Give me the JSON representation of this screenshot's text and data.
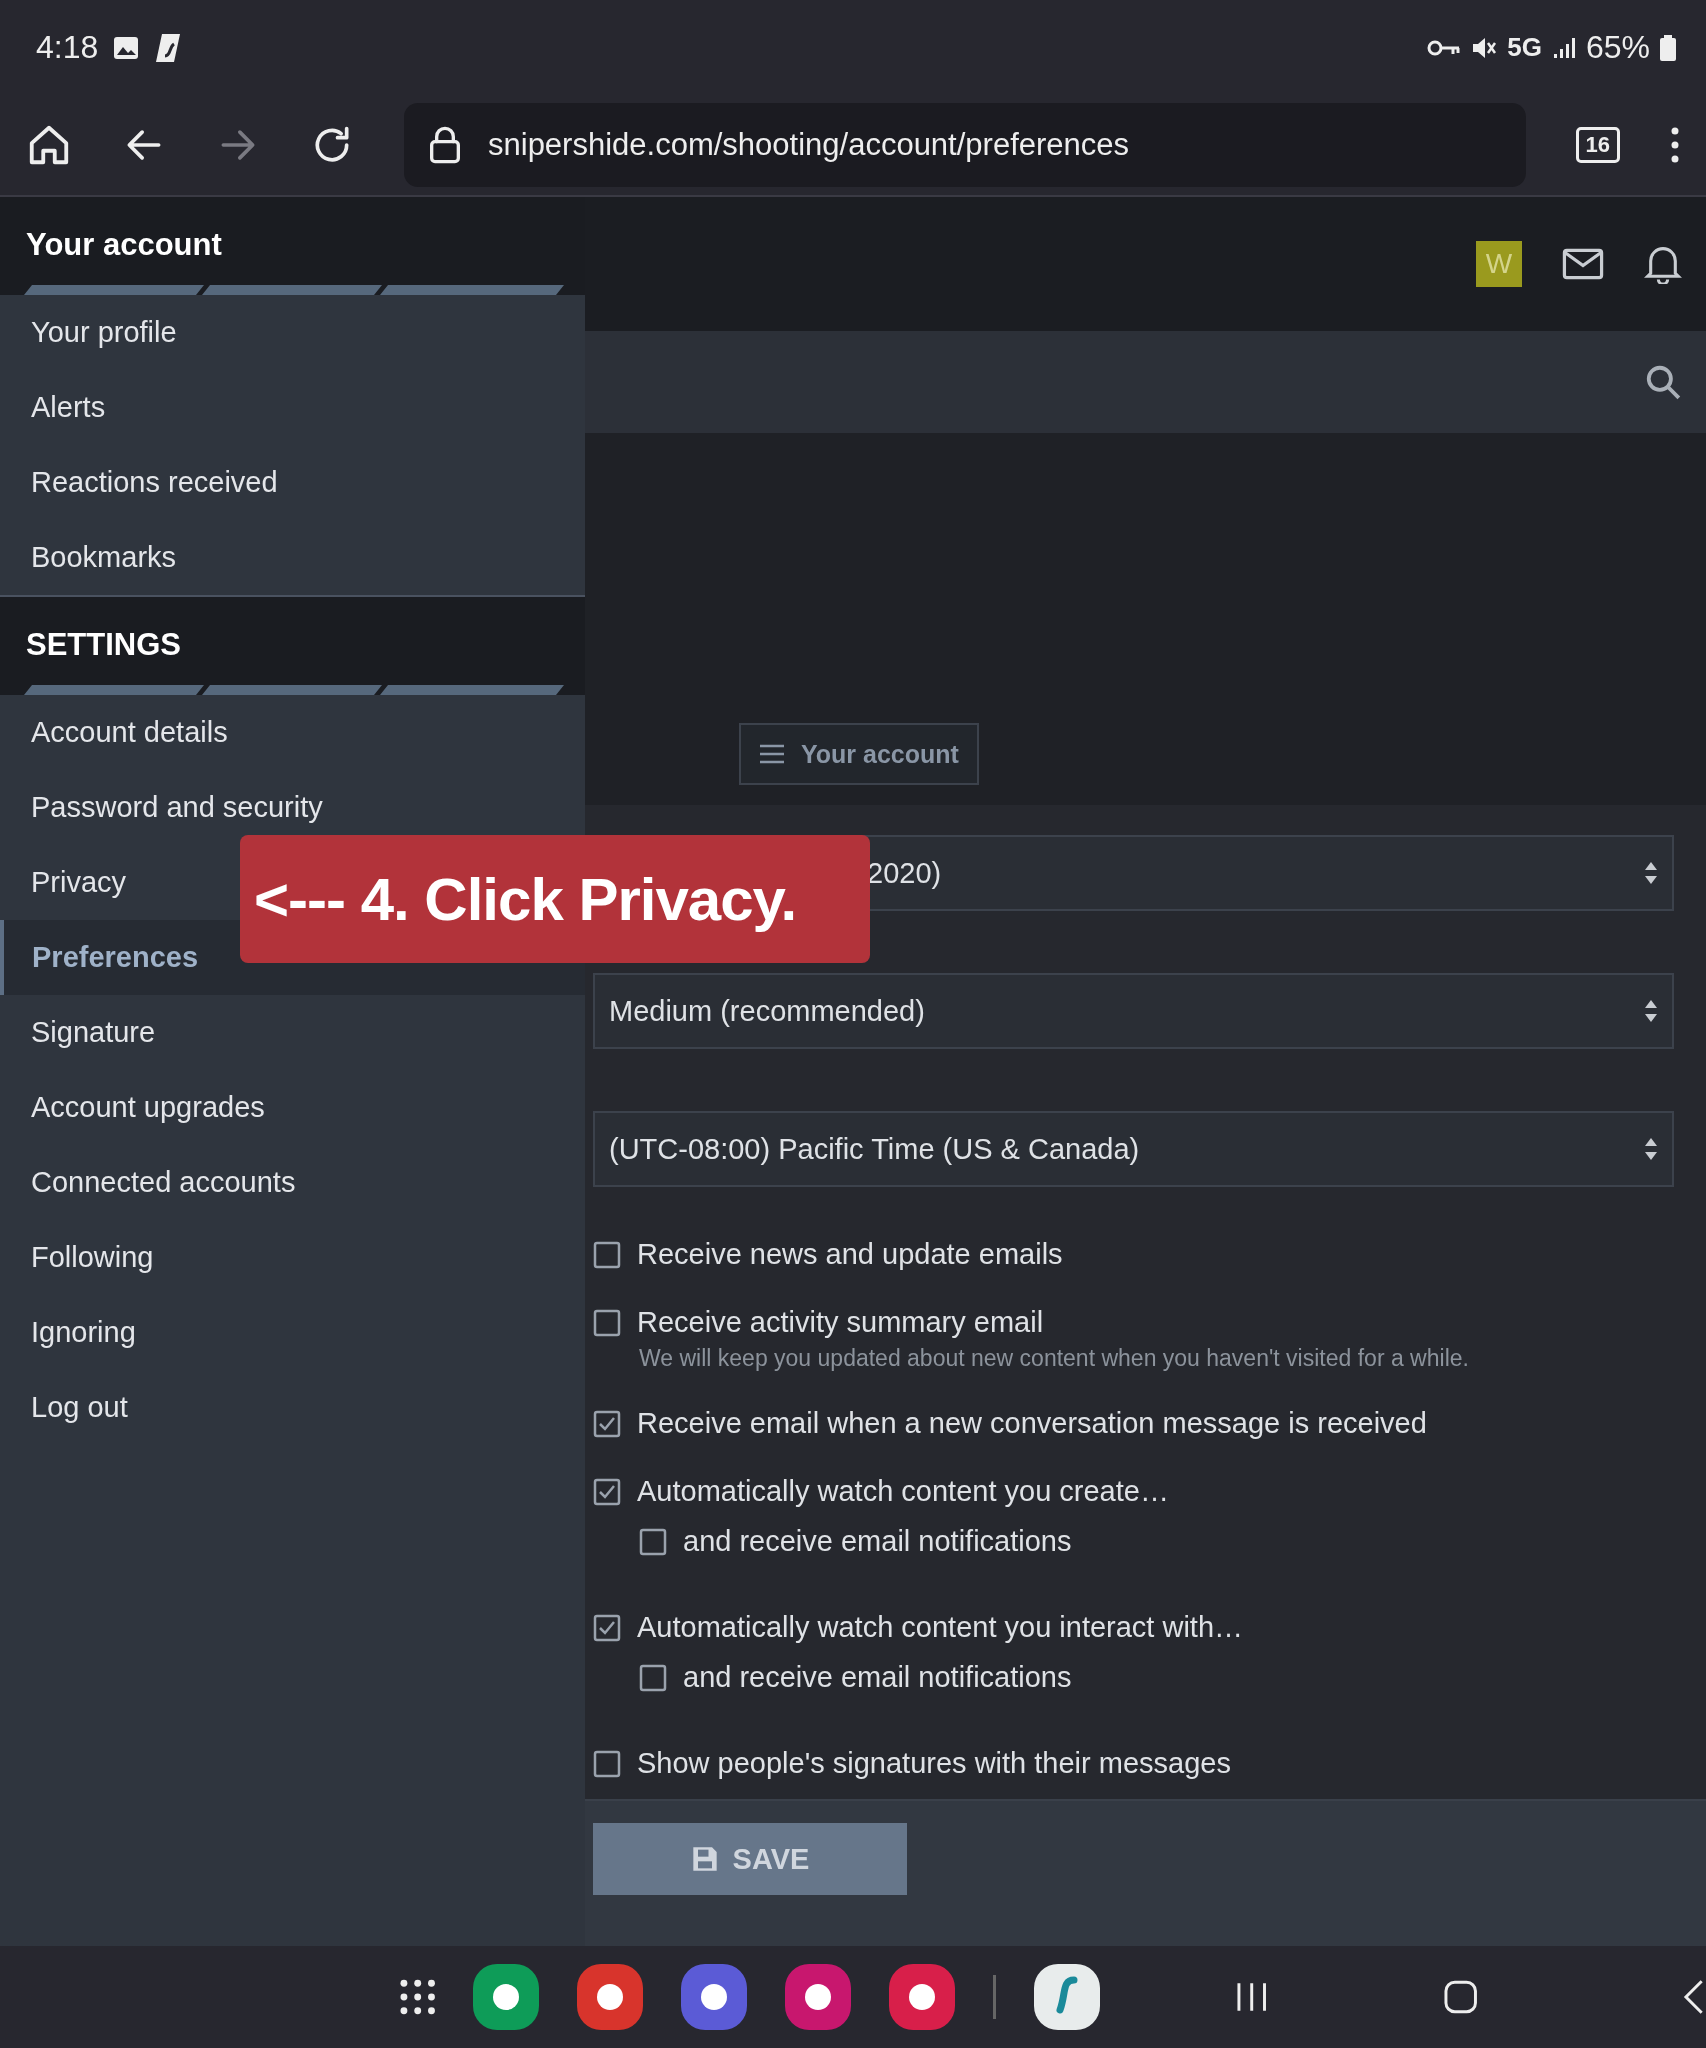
{
  "status_bar": {
    "time": "4:18",
    "network": "5G",
    "battery": "65%"
  },
  "browser": {
    "url": "snipershide.com/shooting/account/preferences",
    "tab_count": "16"
  },
  "header": {
    "avatar_letter": "W"
  },
  "sidebar": {
    "sections": [
      {
        "title": "Your account",
        "items": [
          {
            "label": "Your profile",
            "selected": false
          },
          {
            "label": "Alerts",
            "selected": false
          },
          {
            "label": "Reactions received",
            "selected": false
          },
          {
            "label": "Bookmarks",
            "selected": false
          }
        ]
      },
      {
        "title": "SETTINGS",
        "items": [
          {
            "label": "Account details",
            "selected": false
          },
          {
            "label": "Password and security",
            "selected": false
          },
          {
            "label": "Privacy",
            "selected": false
          },
          {
            "label": "Preferences",
            "selected": true
          },
          {
            "label": "Signature",
            "selected": false
          },
          {
            "label": "Account upgrades",
            "selected": false
          },
          {
            "label": "Connected accounts",
            "selected": false
          },
          {
            "label": "Following",
            "selected": false
          },
          {
            "label": "Ignoring",
            "selected": false
          },
          {
            "label": "Log out",
            "selected": false
          }
        ]
      }
    ]
  },
  "account_button": "Your account",
  "selects": [
    "2020)",
    "Medium (recommended)",
    "(UTC-08:00) Pacific Time (US & Canada)"
  ],
  "options": [
    {
      "label": "Receive news and update emails",
      "checked": false
    },
    {
      "label": "Receive activity summary email",
      "checked": false,
      "hint": "We will keep you updated about new content when you haven't visited for a while."
    },
    {
      "label": "Receive email when a new conversation message is received",
      "checked": true
    },
    {
      "label": "Automatically watch content you create…",
      "checked": true,
      "children": [
        {
          "label": "and receive email notifications",
          "checked": false
        }
      ]
    },
    {
      "label": "Automatically watch content you interact with…",
      "checked": true,
      "children": [
        {
          "label": "and receive email notifications",
          "checked": false
        }
      ]
    },
    {
      "label": "Show people's signatures with their messages",
      "checked": false
    }
  ],
  "save_button": "SAVE",
  "annotation": "<--- 4. Click Privacy."
}
